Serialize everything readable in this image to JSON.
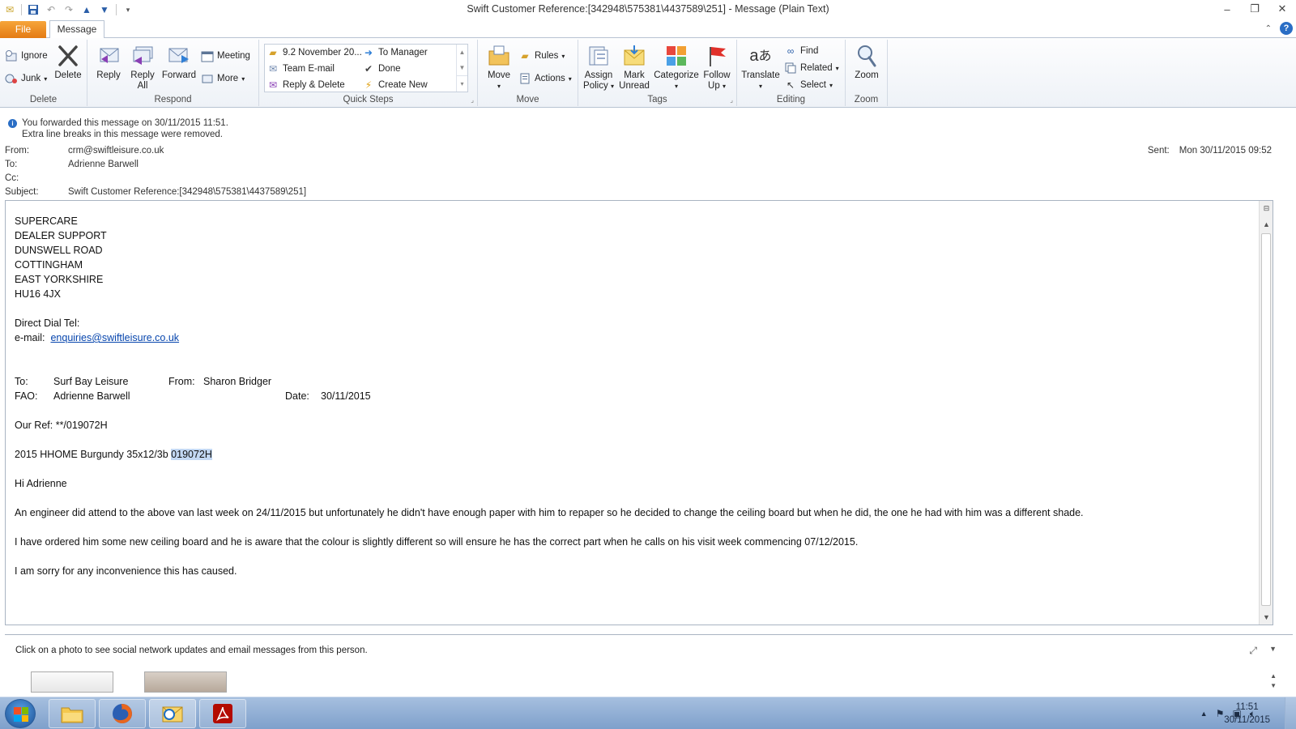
{
  "window": {
    "title": "Swift Customer Reference:[342948\\575381\\4437589\\251]  -  Message (Plain Text)",
    "minimize": "–",
    "maximize": "❐",
    "close": "✕"
  },
  "tabs": {
    "file": "File",
    "message": "Message"
  },
  "ribbon": {
    "delete_group": {
      "label": "Delete",
      "ignore": "Ignore",
      "junk": "Junk",
      "delete": "Delete"
    },
    "respond_group": {
      "label": "Respond",
      "reply": "Reply",
      "reply_all_1": "Reply",
      "reply_all_2": "All",
      "forward": "Forward",
      "meeting": "Meeting",
      "more": "More"
    },
    "quick_steps_group": {
      "label": "Quick Steps",
      "items": [
        "9.2 November 20...",
        "To Manager",
        "Team E-mail",
        "Done",
        "Reply & Delete",
        "Create New"
      ]
    },
    "move_group": {
      "label": "Move",
      "move": "Move",
      "rules": "Rules",
      "actions": "Actions"
    },
    "tags_group": {
      "label": "Tags",
      "assign_1": "Assign",
      "assign_2": "Policy",
      "mark_1": "Mark",
      "mark_2": "Unread",
      "categorize": "Categorize",
      "follow_1": "Follow",
      "follow_2": "Up"
    },
    "editing_group": {
      "label": "Editing",
      "translate": "Translate",
      "find": "Find",
      "related": "Related",
      "select": "Select"
    },
    "zoom_group": {
      "label": "Zoom",
      "zoom": "Zoom"
    }
  },
  "info": {
    "line1": "You forwarded this message on 30/11/2015 11:51.",
    "line2": "Extra line breaks in this message were removed."
  },
  "header": {
    "from_label": "From:",
    "from": "crm@swiftleisure.co.uk",
    "to_label": "To:",
    "to": "Adrienne Barwell",
    "cc_label": "Cc:",
    "cc": "",
    "subject_label": "Subject:",
    "subject": "Swift Customer Reference:[342948\\575381\\4437589\\251]",
    "sent_label": "Sent:",
    "sent": "Mon 30/11/2015 09:52"
  },
  "body": {
    "address": [
      "SUPERCARE",
      "DEALER SUPPORT",
      "DUNSWELL ROAD",
      "COTTINGHAM",
      "EAST YORKSHIRE",
      "HU16 4JX"
    ],
    "direct_dial": "Direct Dial Tel:",
    "email_label": "e-mail:",
    "email_link": "enquiries@swiftleisure.co.uk",
    "to_label": "To:",
    "to_value": "Surf Bay Leisure",
    "from_label": "From:",
    "from_value": "Sharon Bridger",
    "fao_label": "FAO:",
    "fao_value": "Adrienne Barwell",
    "date_label": "Date:",
    "date_value": "30/11/2015",
    "our_ref": "Our Ref: **/019072H",
    "van_prefix": "2015 HHOME Burgundy 35x12/3b ",
    "van_code": "019072H",
    "greeting": "Hi Adrienne",
    "para1": "An engineer did attend to the above van last week on 24/11/2015 but unfortunately he didn't have enough paper with him to repaper so he decided to change the ceiling board but when he did, the one he had with him was a different shade.",
    "para2": "I have ordered him some new ceiling board and he is aware that the colour is slightly different so will ensure he has the correct part when he calls on his visit week commencing 07/12/2015.",
    "para3": "I am sorry for any inconvenience this has caused."
  },
  "people_pane": {
    "message": "Click on a photo to see social network updates and email messages from this person."
  },
  "taskbar": {
    "time": "11:51",
    "date": "30/11/2015"
  }
}
